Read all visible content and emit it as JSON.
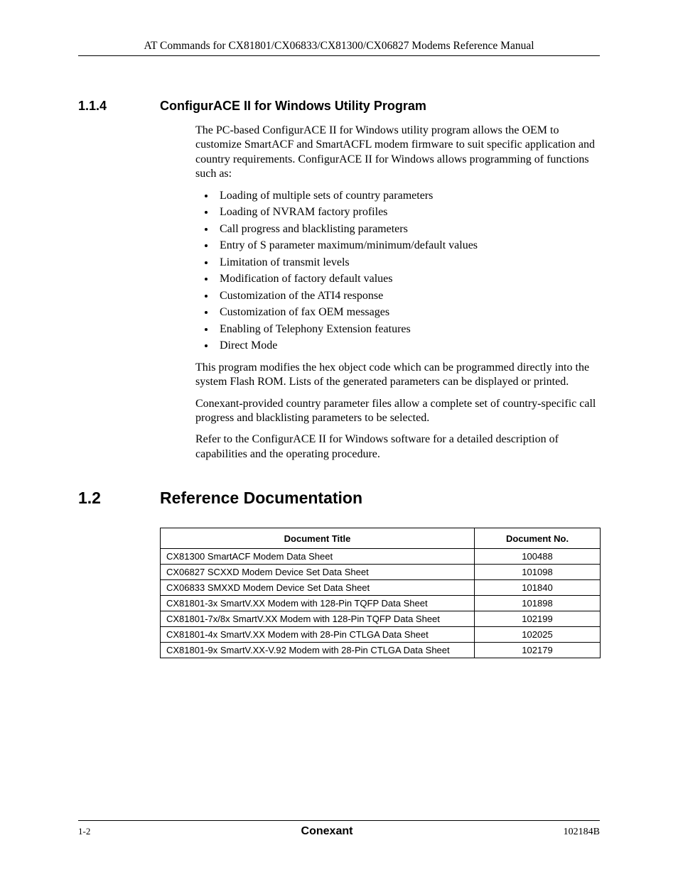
{
  "header": {
    "running": "AT Commands for CX81801/CX06833/CX81300/CX06827 Modems Reference Manual"
  },
  "section114": {
    "num": "1.1.4",
    "title": "ConfigurACE II for Windows Utility Program",
    "intro": "The PC-based ConfigurACE II for Windows utility program allows the OEM to customize SmartACF and SmartACFL modem firmware to suit specific application and country requirements. ConfigurACE II for Windows allows programming of functions such as:",
    "bullets": [
      "Loading of multiple sets of country parameters",
      "Loading of NVRAM factory profiles",
      "Call progress and blacklisting parameters",
      "Entry of S parameter maximum/minimum/default values",
      "Limitation of transmit levels",
      "Modification of factory default values",
      "Customization of the ATI4 response",
      "Customization of fax OEM messages",
      "Enabling of Telephony Extension features",
      "Direct Mode"
    ],
    "p2": "This program modifies the hex object code which can be programmed directly into the system Flash ROM. Lists of the generated parameters can be displayed or printed.",
    "p3": "Conexant-provided country parameter files allow a complete set of country-specific call progress and blacklisting parameters to be selected.",
    "p4": "Refer to the ConfigurACE II for Windows software for a detailed description of capabilities and the operating procedure."
  },
  "section12": {
    "num": "1.2",
    "title": "Reference Documentation",
    "table": {
      "col_title": "Document Title",
      "col_num": "Document No.",
      "rows": [
        {
          "title": "CX81300 SmartACF Modem Data Sheet",
          "num": "100488"
        },
        {
          "title": "CX06827 SCXXD Modem Device Set Data Sheet",
          "num": "101098"
        },
        {
          "title": "CX06833 SMXXD Modem Device Set Data Sheet",
          "num": "101840"
        },
        {
          "title": "CX81801-3x SmartV.XX Modem with 128-Pin TQFP Data Sheet",
          "num": "101898"
        },
        {
          "title": "CX81801-7x/8x SmartV.XX Modem with 128-Pin TQFP Data Sheet",
          "num": "102199"
        },
        {
          "title": "CX81801-4x SmartV.XX Modem with 28-Pin CTLGA Data Sheet",
          "num": "102025"
        },
        {
          "title": "CX81801-9x SmartV.XX-V.92 Modem with 28-Pin CTLGA Data Sheet",
          "num": "102179"
        }
      ]
    }
  },
  "footer": {
    "left": "1-2",
    "center": "Conexant",
    "right": "102184B"
  }
}
